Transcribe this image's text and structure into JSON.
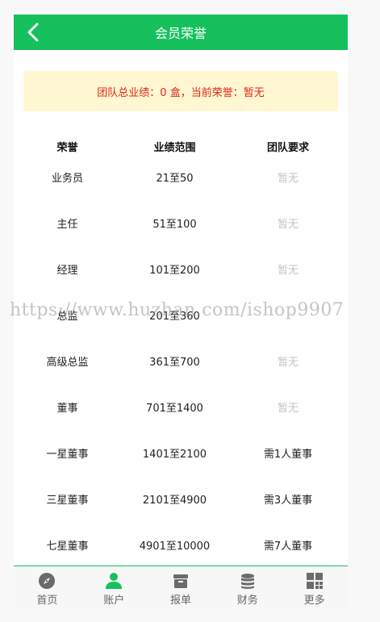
{
  "header": {
    "title": "会员荣誉"
  },
  "notice": {
    "text": "团队总业绩：0 盒，当前荣誉：暂无"
  },
  "table": {
    "headers": [
      "荣誉",
      "业绩范围",
      "团队要求"
    ],
    "rows": [
      [
        "业务员",
        "21至50",
        "暂无"
      ],
      [
        "主任",
        "51至100",
        "暂无"
      ],
      [
        "经理",
        "101至200",
        "暂无"
      ],
      [
        "总监",
        "201至360",
        ""
      ],
      [
        "高级总监",
        "361至700",
        "暂无"
      ],
      [
        "董事",
        "701至1400",
        "暂无"
      ],
      [
        "一星董事",
        "1401至2100",
        "需1人董事"
      ],
      [
        "三星董事",
        "2101至4900",
        "需3人董事"
      ],
      [
        "七星董事",
        "4901至10000",
        "需7人董事"
      ]
    ]
  },
  "watermark": {
    "text": "https://www.huzhan.com/ishop9907"
  },
  "tabbar": {
    "items": [
      {
        "label": "首页",
        "icon": "compass-icon"
      },
      {
        "label": "账户",
        "icon": "user-icon"
      },
      {
        "label": "报单",
        "icon": "box-icon"
      },
      {
        "label": "财务",
        "icon": "coins-icon"
      },
      {
        "label": "更多",
        "icon": "grid-icon"
      }
    ]
  },
  "colors": {
    "brand": "#16c05c",
    "notice_bg": "#fef7d1",
    "notice_text": "#e1251b",
    "muted": "#c4c4c4"
  }
}
